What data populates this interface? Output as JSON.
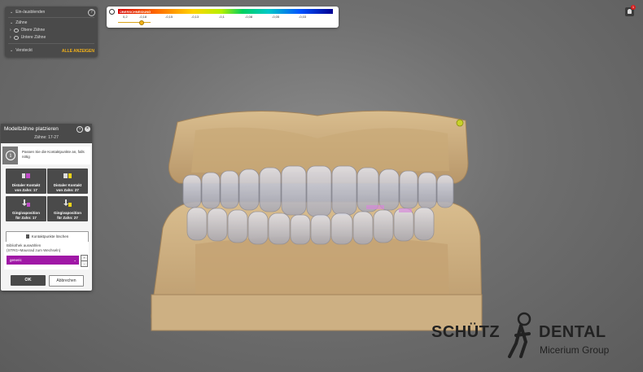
{
  "visibility_panel": {
    "title": "Ein-/ausblenden",
    "items": [
      {
        "label": "Zähne"
      },
      {
        "label": "Obere Zähne"
      },
      {
        "label": "Untere Zähne"
      }
    ],
    "hidden_label": "Versteckt",
    "show_all_label": "ALLE ANZEIGEN",
    "help": "?"
  },
  "scale": {
    "title": "ÜBERSCHNEIDUNG",
    "ticks": [
      "0,2",
      "-0,18",
      "-0,15",
      "-0,13",
      "-0,1",
      "-0,08",
      "-0,05",
      "-0,03"
    ],
    "accent": "#f3b21a"
  },
  "notification": {
    "count": "1"
  },
  "dialog": {
    "title": "Modellzähne platzieren",
    "subtitle": "Zähne: 17-27",
    "help": "?",
    "close": "×",
    "info_text": "Passen Sie die Kontaktpunkte an, falls nötig",
    "tiles": [
      {
        "label_1": "Distaler Kontakt",
        "label_2": "von Zahn: 17"
      },
      {
        "label_1": "Distaler Kontakt",
        "label_2": "von Zahn: 27"
      },
      {
        "label_1": "Gingivaposition",
        "label_2": "für Zahn: 17"
      },
      {
        "label_1": "Gingivaposition",
        "label_2": "für Zahn: 27"
      }
    ],
    "delete_label": "Kontaktpunkte löschen",
    "library_label_1": "Bibliothek auswählen",
    "library_label_2": "(STRG+Mausrad zum Wechseln)",
    "library_value": "generic",
    "library_up": "+",
    "library_down": "-",
    "ok_label": "OK",
    "cancel_label": "Abbrechen",
    "accent": "#a018a6"
  },
  "brand": {
    "name_left": "SCHÜTZ",
    "name_right": "DENTAL",
    "group": "Micerium Group"
  }
}
